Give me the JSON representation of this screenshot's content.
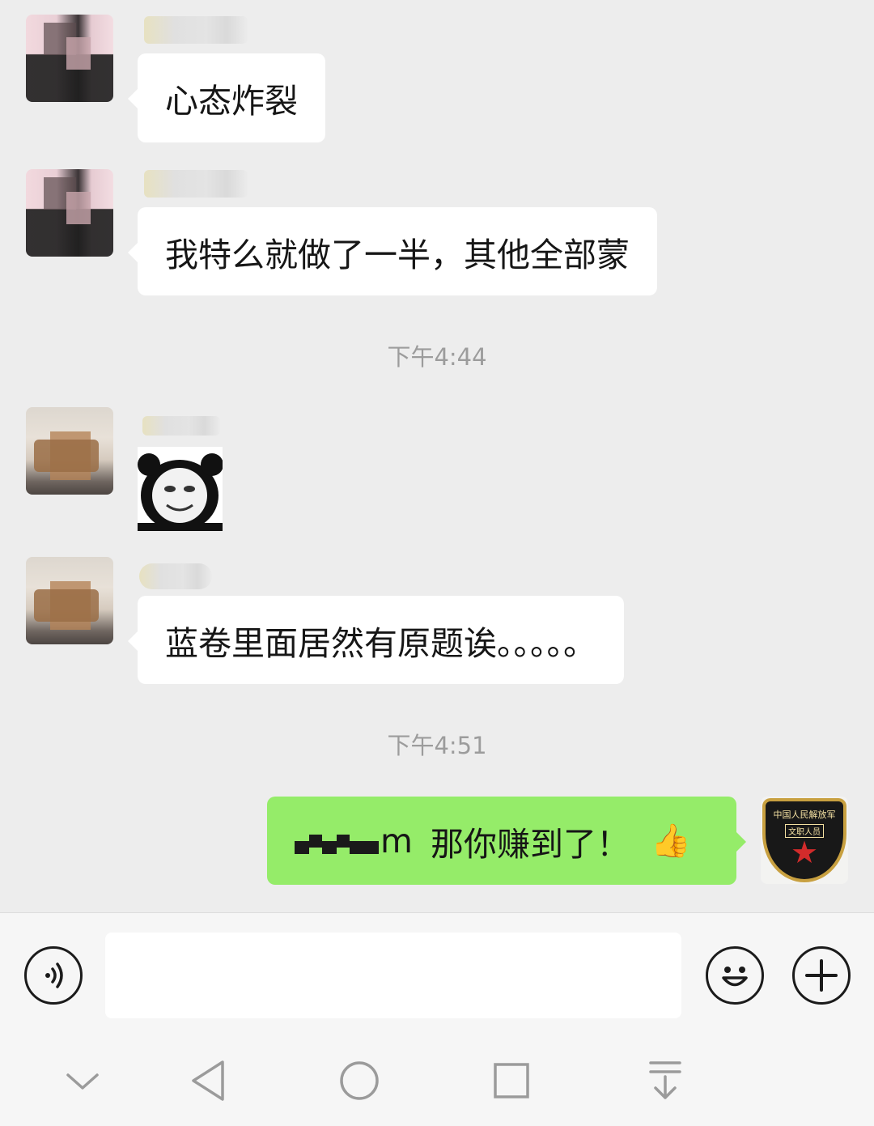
{
  "messages": [
    {
      "sender": "other",
      "text": "心态炸裂"
    },
    {
      "sender": "other",
      "text": "我特么就做了一半，其他全部蒙"
    },
    {
      "timestamp": "下午4:44"
    },
    {
      "sender": "other",
      "type": "sticker",
      "sticker": "panda-face-meme"
    },
    {
      "sender": "other",
      "text": "蓝卷里面居然有原题诶。。。。。"
    },
    {
      "timestamp": "下午4:51"
    },
    {
      "sender": "self",
      "visible_text": "m 那你赚到了！",
      "emoji": "thumbs-up"
    }
  ],
  "chat": {
    "msg1_text": "心态炸裂",
    "msg2_text": "我特么就做了一半，其他全部蒙",
    "time1": "下午4:44",
    "msg4_text": "蓝卷里面居然有原题诶。。。。。",
    "time2": "下午4:51",
    "msg5_suffix": "m",
    "msg5_text": "那你赚到了！",
    "thumb_glyph": "👍"
  },
  "self_avatar": {
    "line1": "中国人民解放军",
    "line2": "文职人员"
  },
  "input_bar": {
    "voice_icon": "voice-icon",
    "emoji_icon": "emoji-icon",
    "plus_icon": "plus-icon"
  },
  "nav_bar": {
    "icons": [
      "chevron-down-icon",
      "back-icon",
      "home-icon",
      "recent-apps-icon",
      "notification-pull-icon"
    ]
  },
  "colors": {
    "background": "#ededed",
    "bubble_other": "#ffffff",
    "bubble_self": "#95ec69",
    "timestamp": "#9c9c9c"
  }
}
